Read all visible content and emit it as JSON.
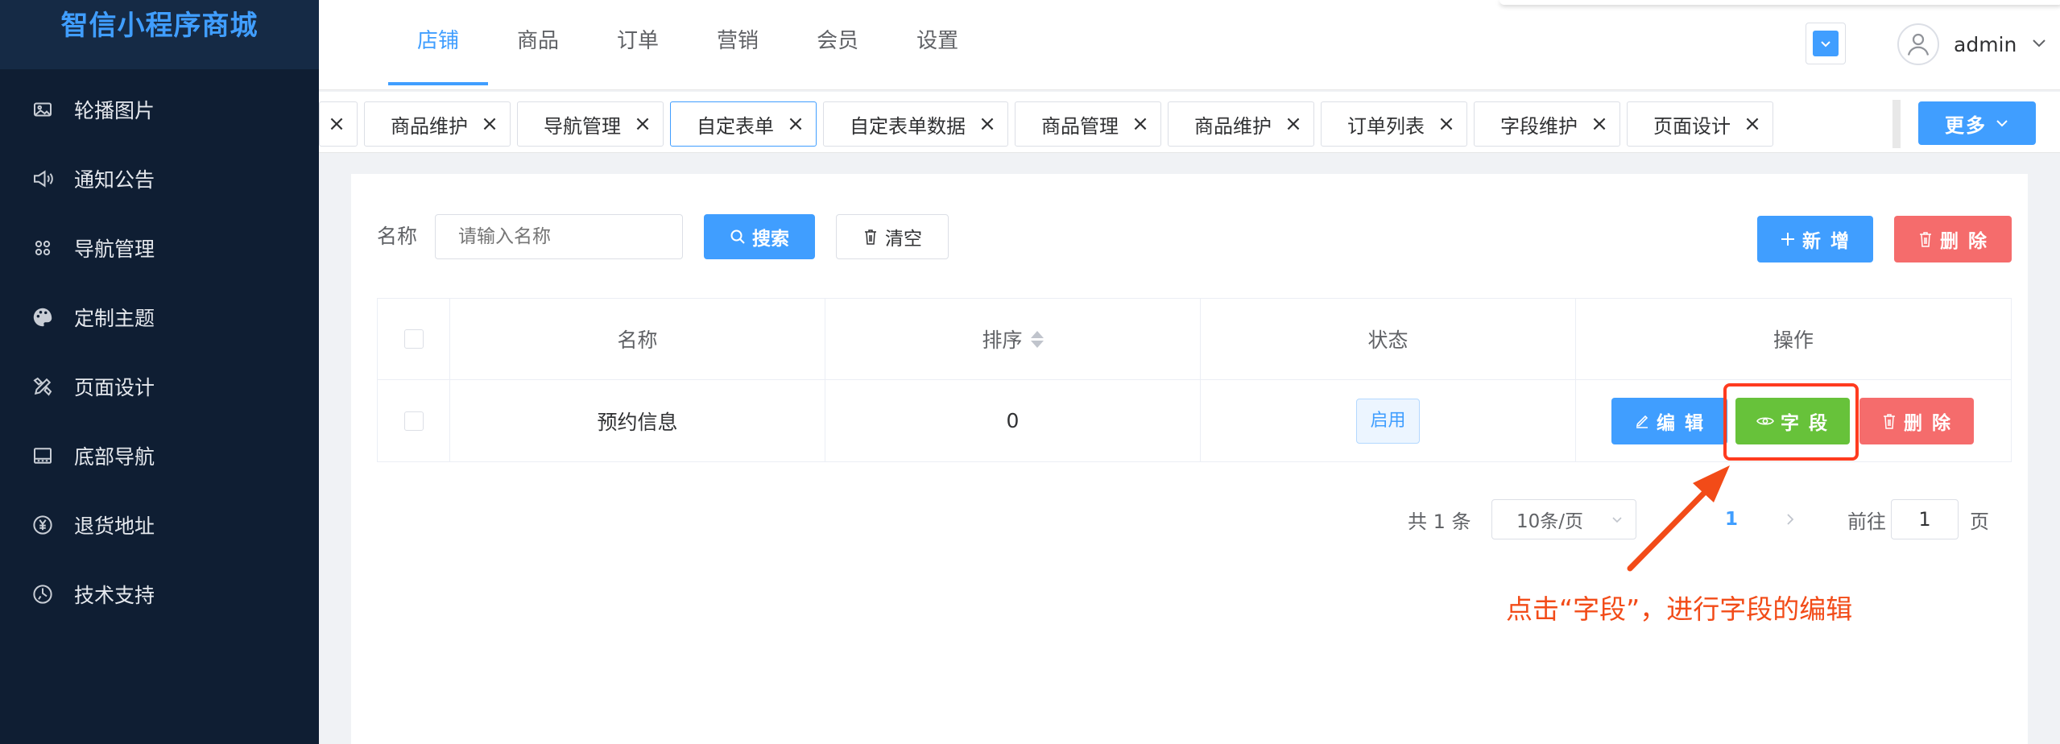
{
  "app": {
    "brand": "智信小程序商城"
  },
  "sidebar": {
    "items": [
      {
        "label": "轮播图片",
        "icon": "image-icon"
      },
      {
        "label": "通知公告",
        "icon": "speaker-icon"
      },
      {
        "label": "导航管理",
        "icon": "grid-icon"
      },
      {
        "label": "定制主题",
        "icon": "palette-icon"
      },
      {
        "label": "页面设计",
        "icon": "design-icon"
      },
      {
        "label": "底部导航",
        "icon": "monitor-icon"
      },
      {
        "label": "退货地址",
        "icon": "yen-icon"
      },
      {
        "label": "技术支持",
        "icon": "support-icon"
      }
    ]
  },
  "header": {
    "nav": [
      "店铺",
      "商品",
      "订单",
      "营销",
      "会员",
      "设置"
    ],
    "active_nav": "店铺",
    "user": "admin"
  },
  "tags": {
    "items": [
      "商品维护",
      "导航管理",
      "自定表单",
      "自定表单数据",
      "商品管理",
      "商品维护",
      "订单列表",
      "字段维护",
      "页面设计"
    ],
    "active": "自定表单",
    "more_label": "更多"
  },
  "filter": {
    "name_label": "名称",
    "name_placeholder": "请输入名称",
    "search_label": "搜索",
    "clear_label": "清空",
    "add_label": "新 增",
    "delete_label": "删 除"
  },
  "table": {
    "headers": [
      "名称",
      "排序",
      "状态",
      "操作"
    ],
    "rows": [
      {
        "name": "预约信息",
        "sort": "0",
        "status": "启用"
      }
    ],
    "actions": {
      "edit": "编 辑",
      "field": "字 段",
      "delete": "删 除"
    }
  },
  "pagination": {
    "total": "共 1 条",
    "page_size": "10条/页",
    "current": "1",
    "goto_label": "前往",
    "goto_value": "1",
    "goto_unit": "页"
  },
  "annotation": {
    "text": "点击“字段”，进行字段的编辑",
    "color": "#f24b18"
  },
  "colors": {
    "primary": "#409eff",
    "success": "#67c23a",
    "danger": "#f56c6c",
    "sidebar_bg": "#0f1e33"
  }
}
